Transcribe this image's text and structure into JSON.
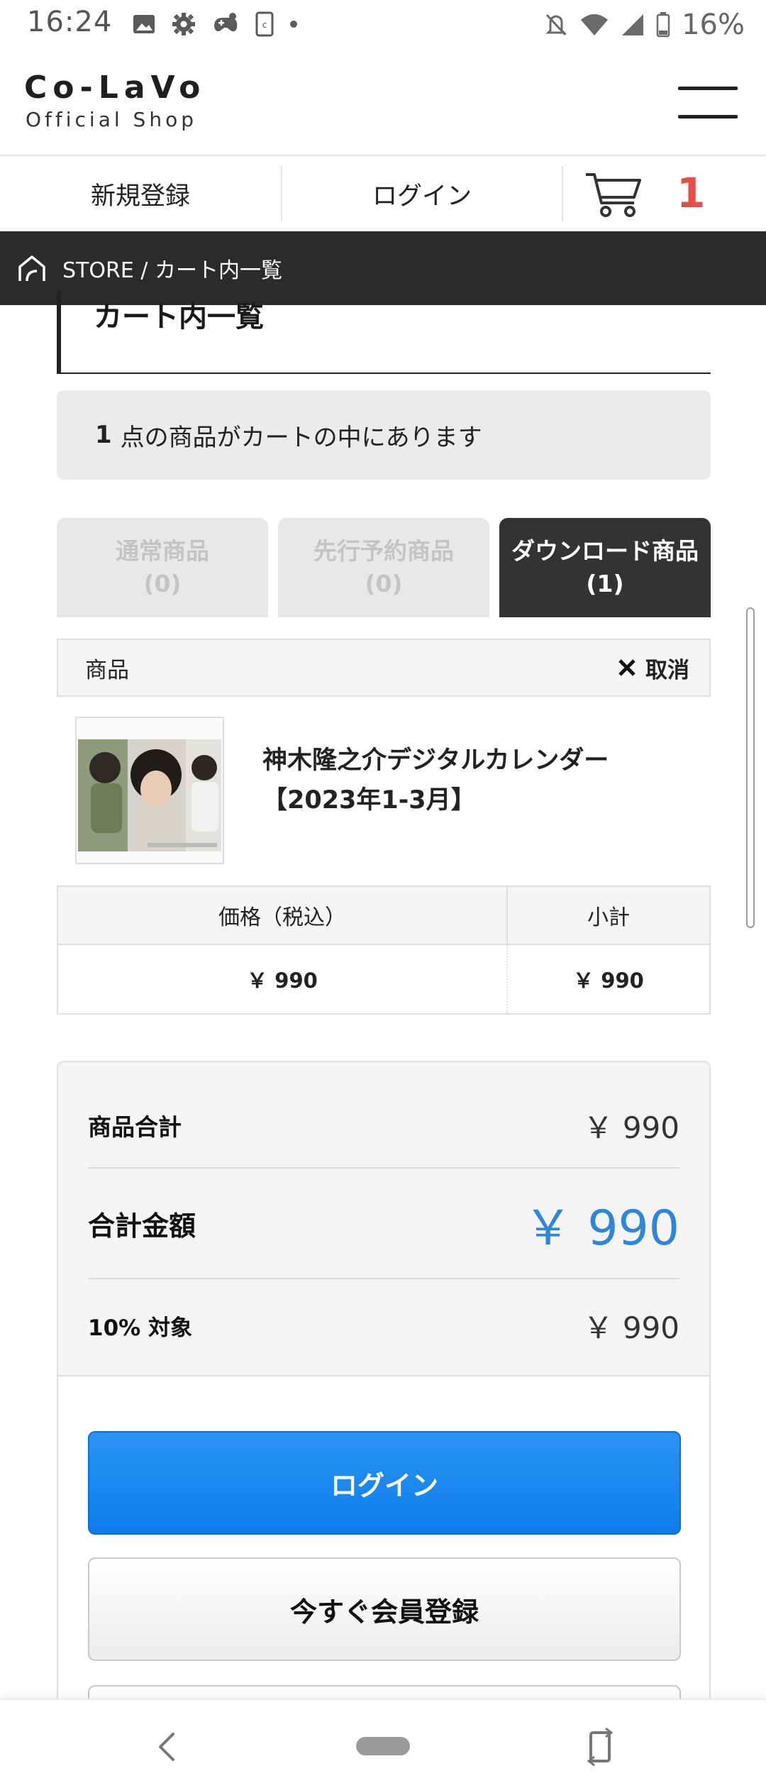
{
  "status_bar": {
    "time": "16:24",
    "battery": "16%",
    "icons_left": [
      "image-icon",
      "settings-gear-icon",
      "game-controller-icon",
      "phone-app-icon",
      "dot-icon"
    ],
    "icons_right": [
      "notifications-off-icon",
      "wifi-icon",
      "cell-signal-icon",
      "battery-icon"
    ]
  },
  "header": {
    "logo_main": "Co-LaVo",
    "logo_sub": "Official Shop"
  },
  "login_bar": {
    "register": "新規登録",
    "login": "ログイン",
    "cart_count": "1"
  },
  "breadcrumb": {
    "text": "STORE / カート内一覧"
  },
  "page": {
    "title": "カート内一覧",
    "notice_count": "1",
    "notice_text": "点の商品がカートの中にあります"
  },
  "tabs": [
    {
      "label": "通常商品",
      "count": "(0)",
      "active": false
    },
    {
      "label": "先行予約商品",
      "count": "(0)",
      "active": false
    },
    {
      "label": "ダウンロード商品",
      "count": "(1)",
      "active": true
    }
  ],
  "cart_table": {
    "col_item": "商品",
    "cancel": "取消",
    "product_name_line1": "神木隆之介デジタルカレンダー",
    "product_name_line2": "【2023年1-3月】",
    "price_header": "価格（税込）",
    "subtotal_header": "小計",
    "price": "￥ 990",
    "subtotal": "￥ 990"
  },
  "summary": {
    "items_total_label": "商品合計",
    "items_total_value": "￥ 990",
    "grand_total_label": "合計金額",
    "grand_total_value": "￥ 990",
    "tax_label": "10% 対象",
    "tax_value": "￥ 990"
  },
  "buttons": {
    "login": "ログイン",
    "register_now": "今すぐ会員登録"
  },
  "colors": {
    "accent_blue": "#2f86d8",
    "cart_count_red": "#e2504a",
    "breadcrumb_bg": "#2b2b2b",
    "active_tab_bg": "#333333"
  }
}
